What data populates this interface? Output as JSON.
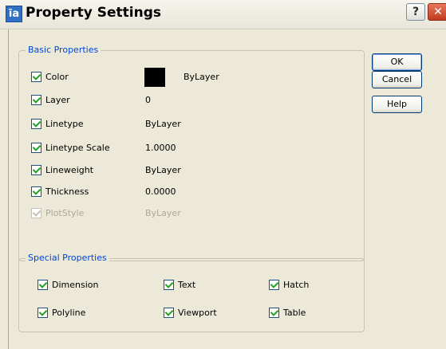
{
  "window": {
    "title": "Property Settings",
    "icon": "app-icon",
    "help_glyph": "?",
    "close_glyph": "✕"
  },
  "basic": {
    "legend": "Basic Properties",
    "color": {
      "label": "Color",
      "value": "ByLayer",
      "swatch": "#000000",
      "checked": true
    },
    "layer": {
      "label": "Layer",
      "value": "0",
      "checked": true
    },
    "linetype": {
      "label": "Linetype",
      "value": "ByLayer",
      "checked": true
    },
    "linetype_scale": {
      "label": "Linetype Scale",
      "value": "1.0000",
      "checked": true
    },
    "lineweight": {
      "label": "Lineweight",
      "value": "ByLayer",
      "checked": true
    },
    "thickness": {
      "label": "Thickness",
      "value": "0.0000",
      "checked": true
    },
    "plotstyle": {
      "label": "PlotStyle",
      "value": "ByLayer",
      "checked": true,
      "disabled": true
    }
  },
  "special": {
    "legend": "Special Properties",
    "items": [
      {
        "label": "Dimension",
        "checked": true
      },
      {
        "label": "Text",
        "checked": true
      },
      {
        "label": "Hatch",
        "checked": true
      },
      {
        "label": "Polyline",
        "checked": true
      },
      {
        "label": "Viewport",
        "checked": true
      },
      {
        "label": "Table",
        "checked": true
      }
    ]
  },
  "buttons": {
    "ok": "OK",
    "cancel": "Cancel",
    "help": "Help"
  },
  "colors": {
    "legend": "#0046d5",
    "dialog_bg": "#ece9d8",
    "check": "#21a121"
  }
}
